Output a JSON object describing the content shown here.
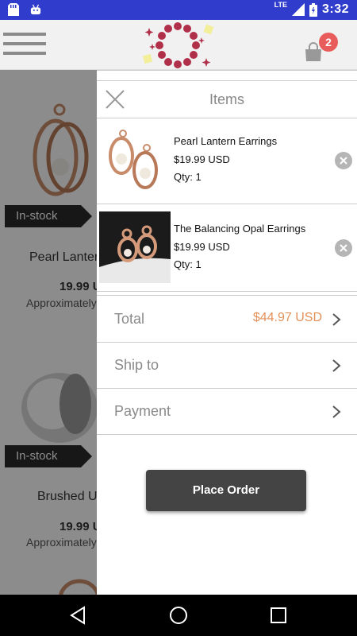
{
  "status_bar": {
    "network": "LTE",
    "time": "3:32"
  },
  "app_bar": {
    "cart_count": "2"
  },
  "background_products": [
    {
      "badge": "In-stock",
      "name": "Pearl Lanter",
      "price": "19.99 U",
      "approx": "Approximately"
    },
    {
      "badge": "In-stock",
      "name": "Brushed U",
      "price": "19.99 U",
      "approx": "Approximately"
    }
  ],
  "cart": {
    "title": "Items",
    "items": [
      {
        "name": "Pearl Lantern Earrings",
        "price": "$19.99 USD",
        "qty": "Qty: 1"
      },
      {
        "name": "The Balancing Opal Earrings",
        "price": "$19.99 USD",
        "qty": "Qty: 1"
      }
    ],
    "total_label": "Total",
    "total_value": "$44.97 USD",
    "ship_label": "Ship to",
    "payment_label": "Payment",
    "place_order": "Place Order"
  },
  "colors": {
    "status_bar": "#2f3ccc",
    "accent_total": "#e3915a",
    "badge": "#e85c5c",
    "button": "#444444"
  }
}
